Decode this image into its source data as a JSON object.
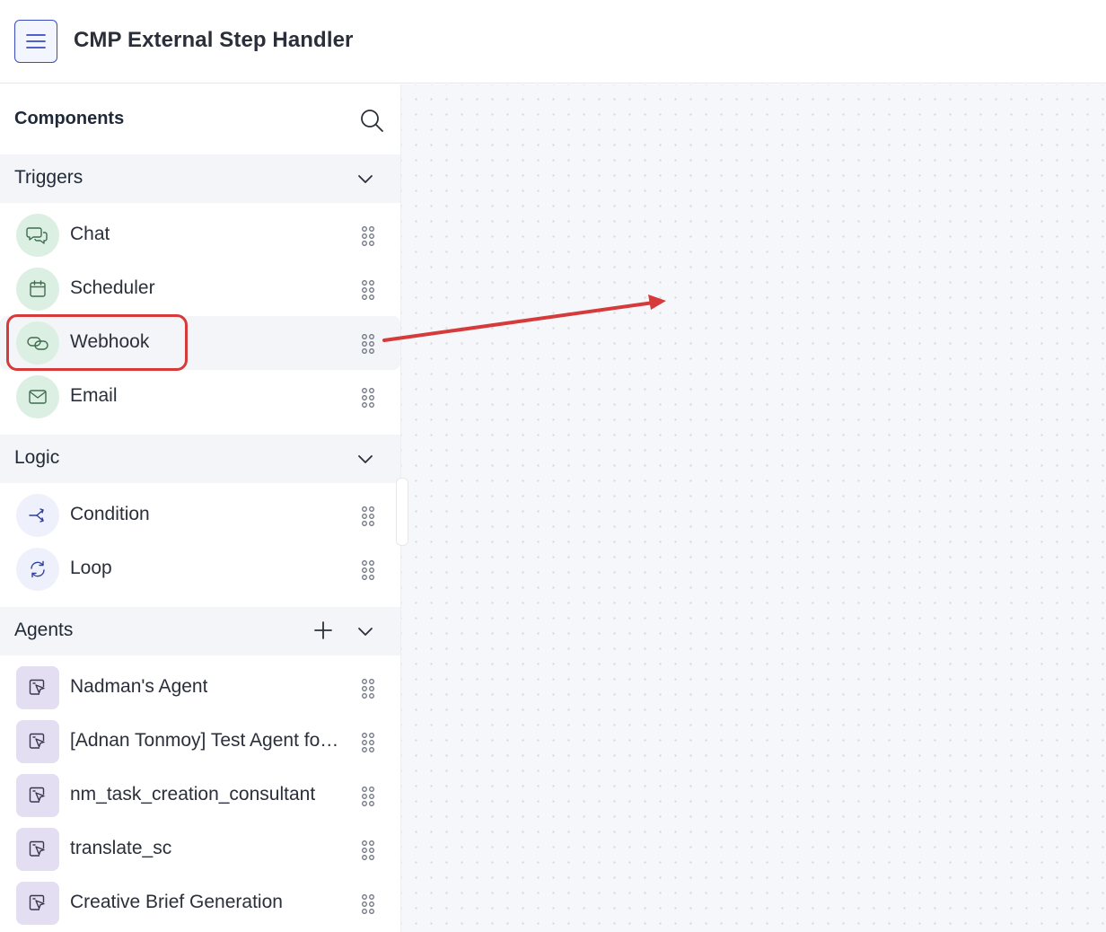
{
  "header": {
    "title": "CMP External Step Handler"
  },
  "sidebar": {
    "title": "Components",
    "sections": [
      {
        "title": "Triggers",
        "items": [
          {
            "label": "Chat",
            "icon": "chat-bubbles-icon"
          },
          {
            "label": "Scheduler",
            "icon": "calendar-icon"
          },
          {
            "label": "Webhook",
            "icon": "link-icon"
          },
          {
            "label": "Email",
            "icon": "envelope-icon"
          }
        ]
      },
      {
        "title": "Logic",
        "items": [
          {
            "label": "Condition",
            "icon": "branch-icon"
          },
          {
            "label": "Loop",
            "icon": "loop-icon"
          }
        ]
      },
      {
        "title": "Agents",
        "items": [
          {
            "label": "Nadman's Agent",
            "icon": "agent-icon"
          },
          {
            "label": "[Adnan Tonmoy] Test Agent for Webhook",
            "icon": "agent-icon"
          },
          {
            "label": "nm_task_creation_consultant",
            "icon": "agent-icon"
          },
          {
            "label": "translate_sc",
            "icon": "agent-icon"
          },
          {
            "label": "Creative Brief Generation",
            "icon": "agent-icon"
          }
        ]
      }
    ]
  },
  "colors": {
    "accent": "#3b4cc0",
    "trigger_icon_bg": "#dcefe3",
    "logic_icon_bg": "#eef1fb",
    "agent_icon_bg": "#e4def2",
    "annotation": "#d63a3a",
    "canvas_bg": "#f6f7fa"
  }
}
